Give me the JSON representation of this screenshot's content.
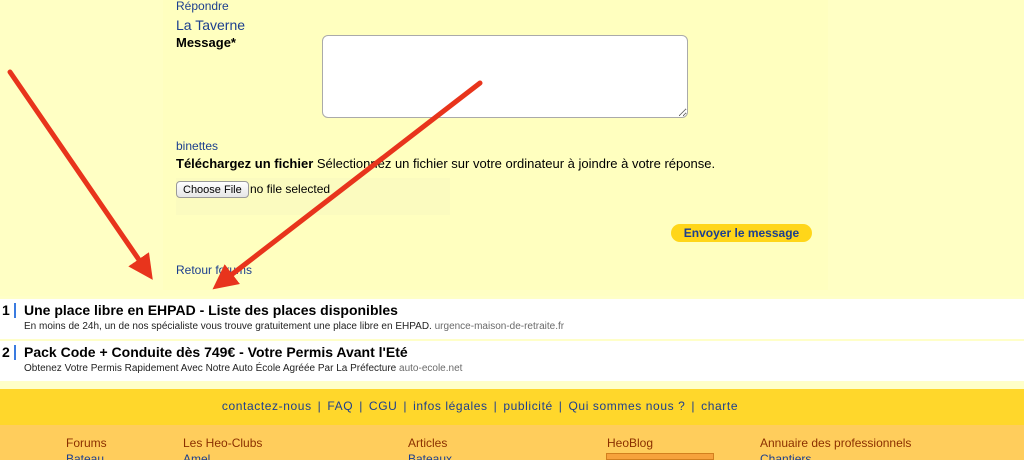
{
  "form": {
    "reply_label": "Répondre",
    "forum_name": "La Taverne",
    "message_label": "Message*",
    "message_value": "",
    "smileys_label": "binettes",
    "upload_title": "Téléchargez un fichier",
    "upload_desc": "Sélectionnez un fichier sur votre ordinateur à joindre à votre réponse.",
    "choose_file_label": "Choose File",
    "no_file_text": "no file selected",
    "send_label": "Envoyer le message",
    "back_label": "Retour forums"
  },
  "annotation": {
    "arrow_color": "#e8341c",
    "arrow_count": 2
  },
  "ads": [
    {
      "number": "1",
      "title": "Une place libre en EHPAD - Liste des places disponibles",
      "description": "En moins de 24h, un de nos spécialiste vous trouve gratuitement une place libre en EHPAD.",
      "domain": "urgence-maison-de-retraite.fr"
    },
    {
      "number": "2",
      "title": "Pack Code + Conduite dès 749€ - Votre Permis Avant l'Eté",
      "description": "Obtenez Votre Permis Rapidement Avec Notre Auto École Agréée Par La Préfecture",
      "domain": "auto-ecole.net"
    }
  ],
  "footer_links": [
    "contactez-nous",
    "FAQ",
    "CGU",
    "infos légales",
    "publicité",
    "Qui sommes nous ?",
    "charte"
  ],
  "footer_columns": [
    {
      "title": "Forums",
      "first_item": "Bateau"
    },
    {
      "title": "Les Heo-Clubs",
      "first_item": "Amel"
    },
    {
      "title": "Articles",
      "first_item": "Bateaux"
    },
    {
      "title": "HeoBlog",
      "first_item": ""
    },
    {
      "title": "Annuaire des professionnels",
      "first_item": "Chantiers"
    }
  ],
  "colors": {
    "page_bg": "#ffffc4",
    "accent_yellow": "#ffd72b",
    "link_blue": "#1c3f8f",
    "footer_orange": "#ffcd5c"
  }
}
